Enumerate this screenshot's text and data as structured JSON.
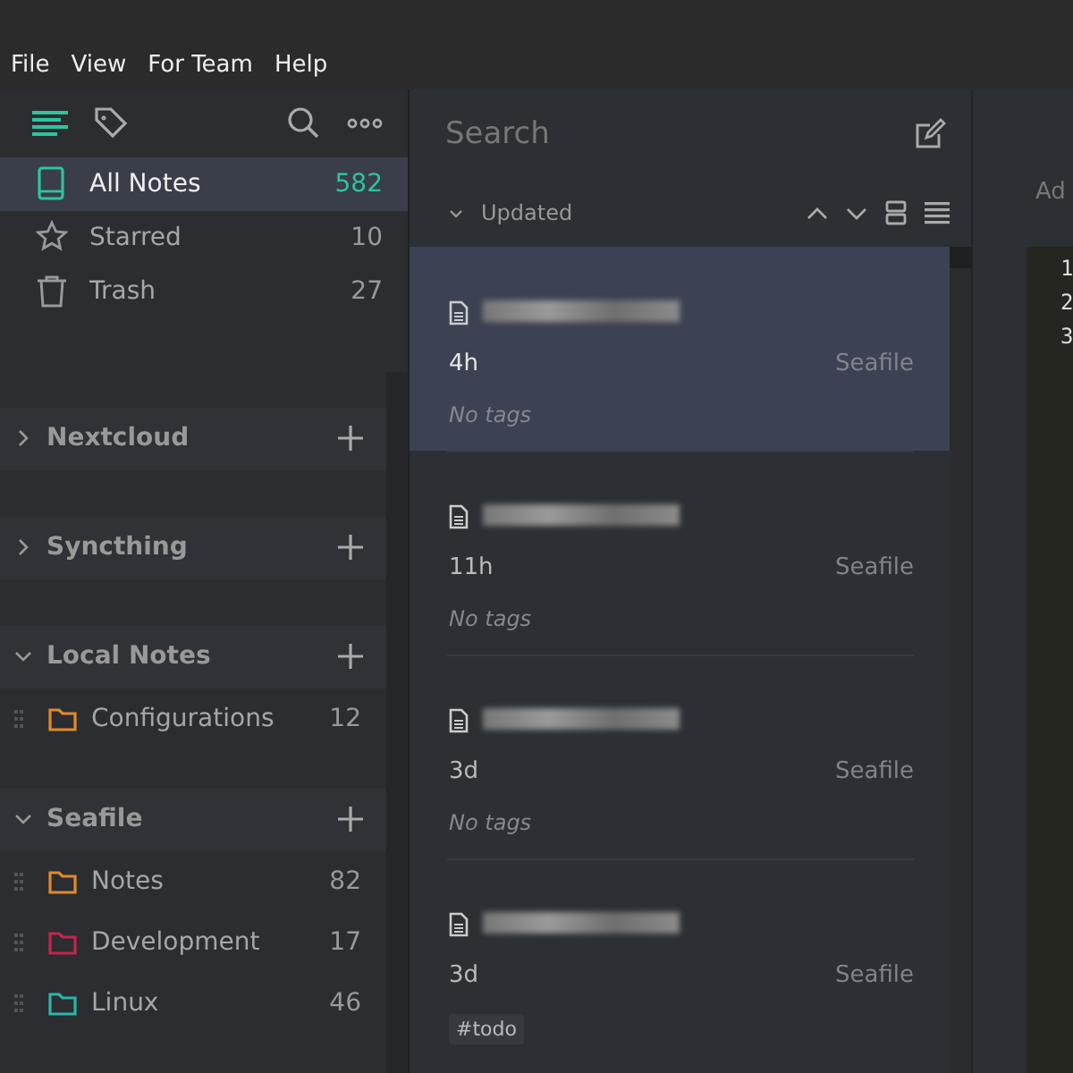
{
  "menu": [
    "File",
    "View",
    "For Team",
    "Help"
  ],
  "sidebar": {
    "items": [
      {
        "kind": "notes",
        "label": "All Notes",
        "count": "582",
        "selected": true
      },
      {
        "kind": "starred",
        "label": "Starred",
        "count": "10",
        "selected": false
      },
      {
        "kind": "trash",
        "label": "Trash",
        "count": "27",
        "selected": false
      }
    ],
    "storages": [
      {
        "name": "Nextcloud",
        "expanded": false
      },
      {
        "name": "Syncthing",
        "expanded": false
      },
      {
        "name": "Local Notes",
        "expanded": true,
        "folders": [
          {
            "name": "Configurations",
            "count": "12",
            "color": "#e08a2c"
          }
        ]
      },
      {
        "name": "Seafile",
        "expanded": true,
        "folders": [
          {
            "name": "Notes",
            "count": "82",
            "color": "#e08a2c"
          },
          {
            "name": "Development",
            "count": "17",
            "color": "#c8224e"
          },
          {
            "name": "Linux",
            "count": "46",
            "color": "#2bb5a8"
          }
        ]
      }
    ]
  },
  "note_list": {
    "search": {
      "placeholder": "Search"
    },
    "sort": {
      "label": "Updated"
    },
    "notes": [
      {
        "time": "4h",
        "storage": "Seafile",
        "no_tags": "No tags",
        "selected": true
      },
      {
        "time": "11h",
        "storage": "Seafile",
        "no_tags": "No tags",
        "selected": false
      },
      {
        "time": "3d",
        "storage": "Seafile",
        "no_tags": "No tags",
        "selected": false
      },
      {
        "time": "3d",
        "storage": "Seafile",
        "tags": [
          "#todo"
        ],
        "selected": false
      }
    ]
  },
  "editor": {
    "button": "Ad",
    "line_numbers": [
      "1",
      "2",
      "3"
    ]
  }
}
